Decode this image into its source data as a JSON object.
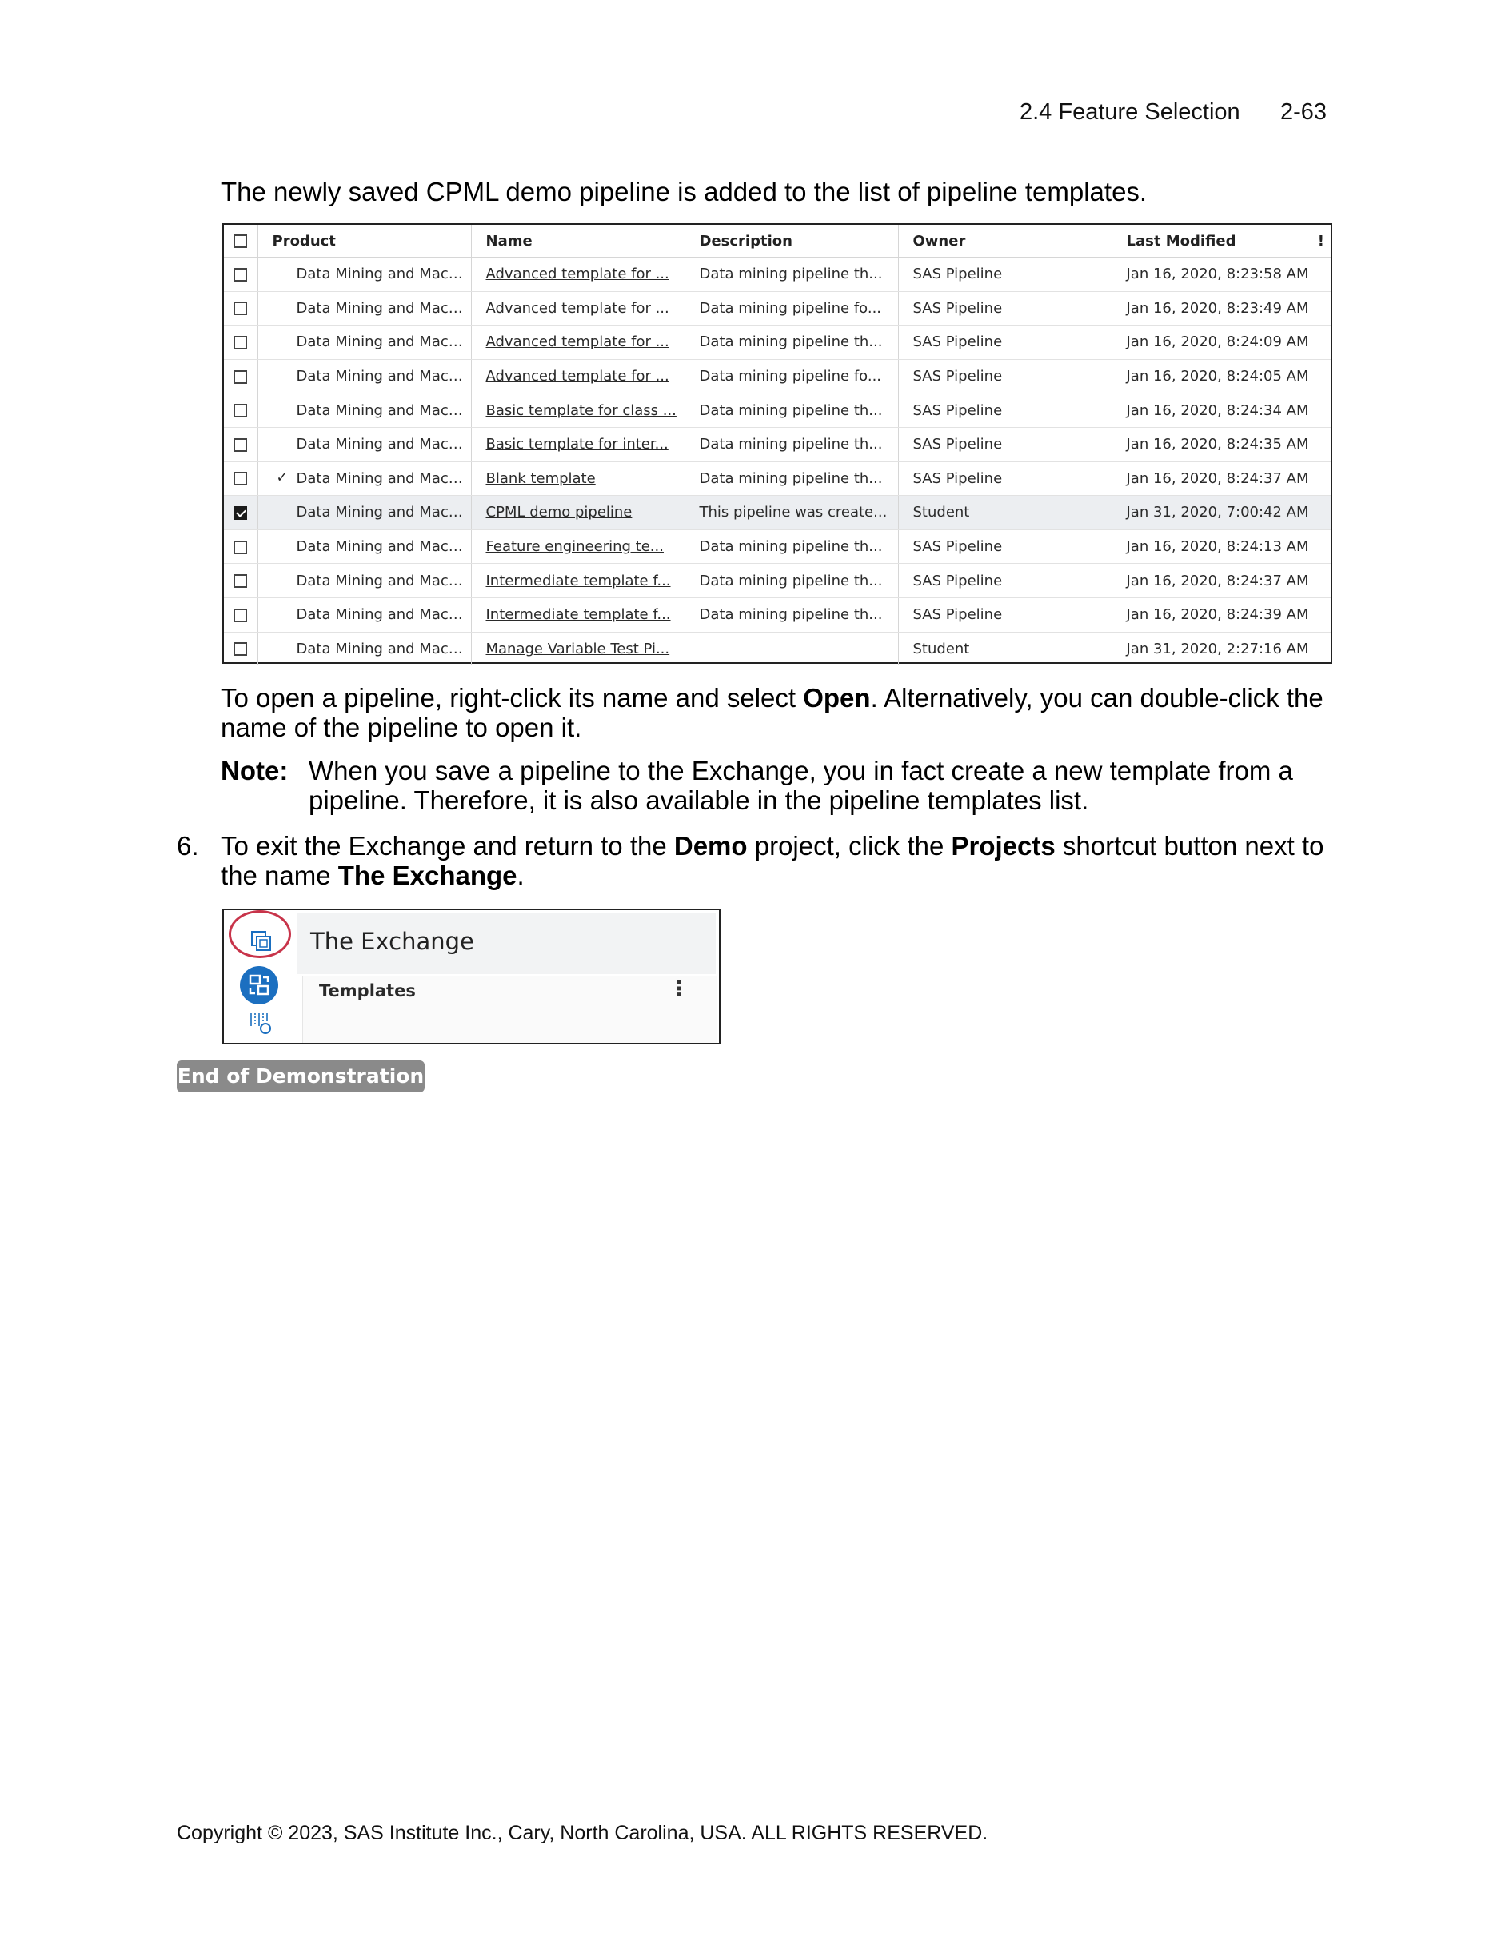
{
  "header": {
    "section": "2.4  Feature Selection",
    "page": "2-63"
  },
  "intro": "The newly saved CPML demo pipeline is added to the list of pipeline templates.",
  "table": {
    "columns": [
      "Product",
      "Name",
      "Description",
      "Owner",
      "Last Modified"
    ],
    "header_alert_icon": "alert-icon",
    "rows": [
      {
        "checked": false,
        "mark": "",
        "product": "Data Mining and Machi...",
        "name": "Advanced template for ...",
        "description": "Data mining pipeline th...",
        "owner": "SAS Pipeline",
        "modified": "Jan 16, 2020, 8:23:58 AM"
      },
      {
        "checked": false,
        "mark": "",
        "product": "Data Mining and Machi...",
        "name": "Advanced template for ...",
        "description": "Data mining pipeline fo...",
        "owner": "SAS Pipeline",
        "modified": "Jan 16, 2020, 8:23:49 AM"
      },
      {
        "checked": false,
        "mark": "",
        "product": "Data Mining and Machi...",
        "name": "Advanced template for ...",
        "description": "Data mining pipeline th...",
        "owner": "SAS Pipeline",
        "modified": "Jan 16, 2020, 8:24:09 AM"
      },
      {
        "checked": false,
        "mark": "",
        "product": "Data Mining and Machi...",
        "name": "Advanced template for ...",
        "description": "Data mining pipeline fo...",
        "owner": "SAS Pipeline",
        "modified": "Jan 16, 2020, 8:24:05 AM"
      },
      {
        "checked": false,
        "mark": "",
        "product": "Data Mining and Machi...",
        "name": "Basic template for class ...",
        "description": "Data mining pipeline th...",
        "owner": "SAS Pipeline",
        "modified": "Jan 16, 2020, 8:24:34 AM"
      },
      {
        "checked": false,
        "mark": "",
        "product": "Data Mining and Machi...",
        "name": "Basic template for inter...",
        "description": "Data mining pipeline th...",
        "owner": "SAS Pipeline",
        "modified": "Jan 16, 2020, 8:24:35 AM"
      },
      {
        "checked": false,
        "mark": "✓",
        "product": "Data Mining and Machi...",
        "name": "Blank template",
        "description": "Data mining pipeline th...",
        "owner": "SAS Pipeline",
        "modified": "Jan 16, 2020, 8:24:37 AM"
      },
      {
        "checked": true,
        "mark": "",
        "product": "Data Mining and Machi...",
        "name": "CPML demo pipeline",
        "description": "This pipeline was create...",
        "owner": "Student",
        "modified": "Jan 31, 2020, 7:00:42 AM"
      },
      {
        "checked": false,
        "mark": "",
        "product": "Data Mining and Machi...",
        "name": "Feature engineering te...",
        "description": "Data mining pipeline th...",
        "owner": "SAS Pipeline",
        "modified": "Jan 16, 2020, 8:24:13 AM"
      },
      {
        "checked": false,
        "mark": "",
        "product": "Data Mining and Machi...",
        "name": "Intermediate template f...",
        "description": "Data mining pipeline th...",
        "owner": "SAS Pipeline",
        "modified": "Jan 16, 2020, 8:24:37 AM"
      },
      {
        "checked": false,
        "mark": "",
        "product": "Data Mining and Machi...",
        "name": "Intermediate template f...",
        "description": "Data mining pipeline th...",
        "owner": "SAS Pipeline",
        "modified": "Jan 16, 2020, 8:24:39 AM"
      },
      {
        "checked": false,
        "mark": "",
        "product": "Data Mining and Machi...",
        "name": "Manage Variable Test Pi...",
        "description": "",
        "owner": "Student",
        "modified": "Jan 31, 2020, 2:27:16 AM"
      }
    ]
  },
  "open_para": {
    "line1_a": "To open a pipeline, right-click its name and select ",
    "line1_bold": "Open",
    "line1_b": ". Alternatively, you can double-click the",
    "line2": "name of the pipeline to open it."
  },
  "note": {
    "label": "Note:",
    "line1": "When you save a pipeline to the Exchange, you in fact create a new template from a",
    "line2": "pipeline. Therefore, it is also available in the pipeline templates list."
  },
  "step": {
    "number": "6.",
    "l1_a": "To exit the Exchange and return to the ",
    "l1_b1": "Demo",
    "l1_c": " project, click the ",
    "l1_b2": "Projects",
    "l1_d": " shortcut button next to",
    "l2_a": "the name ",
    "l2_b": "The Exchange",
    "l2_c": "."
  },
  "exchange": {
    "title": "The Exchange",
    "tab": "Templates",
    "kebab": "⋮",
    "icons": [
      "projects-icon",
      "exchange-icon",
      "manage-variables-icon"
    ],
    "highlight_color": "#c8344a",
    "accent_color": "#1b6fc0"
  },
  "end_badge": "End of Demonstration",
  "copyright": "Copyright © 2023, SAS Institute Inc., Cary, North Carolina, USA. ALL RIGHTS RESERVED."
}
